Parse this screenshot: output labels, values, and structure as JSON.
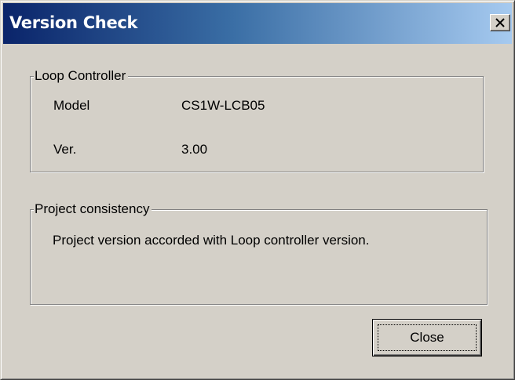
{
  "window": {
    "title": "Version Check"
  },
  "titlebar": {
    "close_glyph": "close-icon"
  },
  "loop_controller": {
    "legend": "Loop Controller",
    "model_label": "Model",
    "model_value": "CS1W-LCB05",
    "version_label": "Ver.",
    "version_value": "3.00"
  },
  "project_consistency": {
    "legend": "Project consistency",
    "message": "Project version accorded with Loop controller version."
  },
  "buttons": {
    "close_label": "Close"
  },
  "colors": {
    "title_start": "#0a246a",
    "title_end": "#a6caf0",
    "face": "#d4d0c8"
  }
}
